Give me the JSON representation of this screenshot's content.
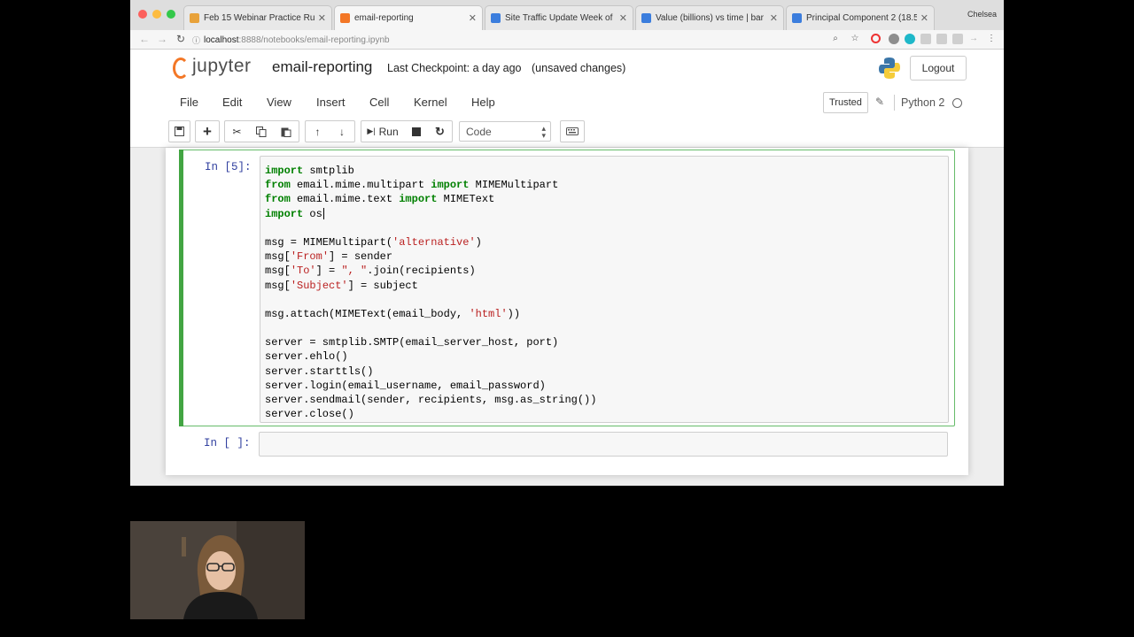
{
  "browser": {
    "tabs": [
      {
        "label": "Feb 15 Webinar Practice Run",
        "favicon_color": "#e8a23a"
      },
      {
        "label": "email-reporting",
        "favicon_color": "#f37726"
      },
      {
        "label": "Site Traffic Update Week of",
        "favicon_color": "#3b7ddd"
      },
      {
        "label": "Value (billions) vs time | bar",
        "favicon_color": "#3b7ddd"
      },
      {
        "label": "Principal Component 2 (18.5",
        "favicon_color": "#3b7ddd"
      }
    ],
    "profile": "Chelsea",
    "url_host": "localhost",
    "url_path": ":8888/notebooks/email-reporting.ipynb"
  },
  "jupyter": {
    "logo_text": "jupyter",
    "notebook_name": "email-reporting",
    "checkpoint": "Last Checkpoint: a day ago",
    "unsaved": "(unsaved changes)",
    "logout": "Logout",
    "menu": [
      "File",
      "Edit",
      "View",
      "Insert",
      "Cell",
      "Kernel",
      "Help"
    ],
    "trusted": "Trusted",
    "kernel": "Python 2",
    "toolbar": {
      "run_label": "Run",
      "cell_type": "Code"
    }
  },
  "cells": [
    {
      "prompt": "In [5]:",
      "lines": [
        [
          {
            "t": "import",
            "c": "kw"
          },
          {
            "t": " smtplib"
          }
        ],
        [
          {
            "t": "from",
            "c": "kw"
          },
          {
            "t": " email.mime.multipart "
          },
          {
            "t": "import",
            "c": "kw"
          },
          {
            "t": " MIMEMultipart"
          }
        ],
        [
          {
            "t": "from",
            "c": "kw"
          },
          {
            "t": " email.mime.text "
          },
          {
            "t": "import",
            "c": "kw"
          },
          {
            "t": " MIMEText"
          }
        ],
        [
          {
            "t": "import",
            "c": "kw"
          },
          {
            "t": " os"
          },
          {
            "cursor": true
          }
        ],
        [],
        [
          {
            "t": "msg = MIMEMultipart("
          },
          {
            "t": "'alternative'",
            "c": "str"
          },
          {
            "t": ")"
          }
        ],
        [
          {
            "t": "msg["
          },
          {
            "t": "'From'",
            "c": "str"
          },
          {
            "t": "] = sender"
          }
        ],
        [
          {
            "t": "msg["
          },
          {
            "t": "'To'",
            "c": "str"
          },
          {
            "t": "] = "
          },
          {
            "t": "\", \"",
            "c": "str"
          },
          {
            "t": ".join(recipients)"
          }
        ],
        [
          {
            "t": "msg["
          },
          {
            "t": "'Subject'",
            "c": "str"
          },
          {
            "t": "] = subject"
          }
        ],
        [],
        [
          {
            "t": "msg.attach(MIMEText(email_body, "
          },
          {
            "t": "'html'",
            "c": "str"
          },
          {
            "t": "))"
          }
        ],
        [],
        [
          {
            "t": "server = smtplib.SMTP(email_server_host, port)"
          }
        ],
        [
          {
            "t": "server.ehlo()"
          }
        ],
        [
          {
            "t": "server.starttls()"
          }
        ],
        [
          {
            "t": "server.login(email_username, email_password)"
          }
        ],
        [
          {
            "t": "server.sendmail(sender, recipients, msg.as_string())"
          }
        ],
        [
          {
            "t": "server.close()"
          }
        ]
      ]
    },
    {
      "prompt": "In [ ]:",
      "lines": []
    }
  ]
}
